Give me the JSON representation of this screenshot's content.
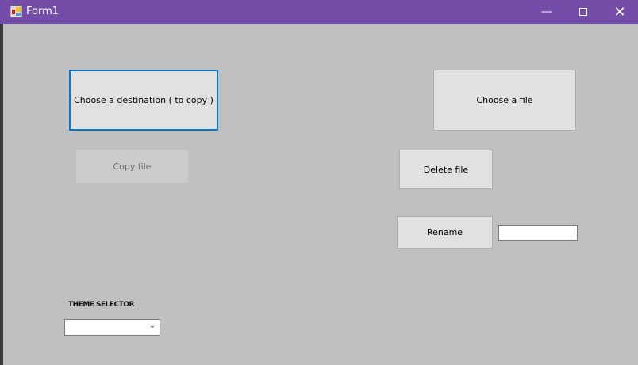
{
  "window": {
    "title": "Form1",
    "minimize_icon": "minimize-icon",
    "maximize_icon": "maximize-icon",
    "close_icon": "close-icon"
  },
  "buttons": {
    "choose_destination": "Choose a destination ( to copy )",
    "choose_file": "Choose a file",
    "copy_file": "Copy file",
    "delete_file": "Delete file",
    "rename": "Rename"
  },
  "rename_input": {
    "value": ""
  },
  "theme": {
    "label": "THEME SELECTOR",
    "selected": ""
  },
  "colors": {
    "titlebar": "#744da9",
    "focus": "#0078d7",
    "background": "#c0c0c0"
  }
}
